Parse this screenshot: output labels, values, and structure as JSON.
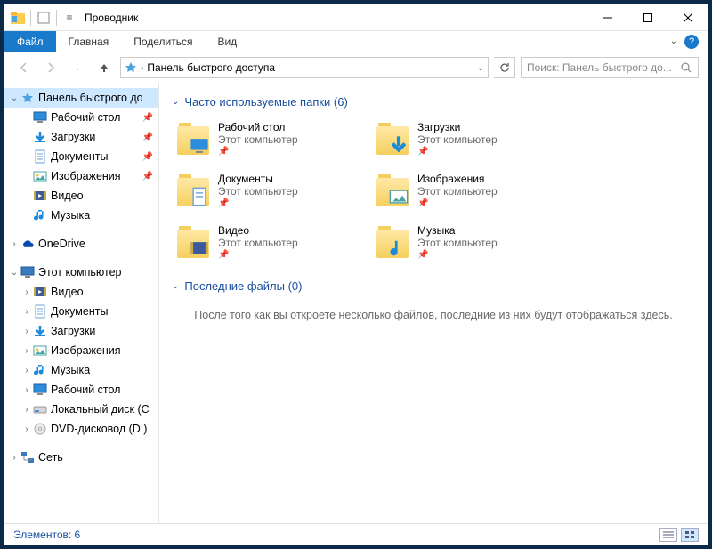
{
  "window": {
    "title": "Проводник"
  },
  "ribbon": {
    "file": "Файл",
    "tabs": [
      "Главная",
      "Поделиться",
      "Вид"
    ]
  },
  "address": {
    "path": "Панель быстрого доступа",
    "search_placeholder": "Поиск: Панель быстрого до..."
  },
  "sidebar": {
    "quick_access": "Панель быстрого до",
    "quick_items": [
      {
        "label": "Рабочий стол",
        "icon": "desktop",
        "pinned": true
      },
      {
        "label": "Загрузки",
        "icon": "downloads",
        "pinned": true
      },
      {
        "label": "Документы",
        "icon": "documents",
        "pinned": true
      },
      {
        "label": "Изображения",
        "icon": "pictures",
        "pinned": true
      },
      {
        "label": "Видео",
        "icon": "video",
        "pinned": false
      },
      {
        "label": "Музыка",
        "icon": "music",
        "pinned": false
      }
    ],
    "onedrive": "OneDrive",
    "this_pc": "Этот компьютер",
    "pc_items": [
      {
        "label": "Видео",
        "icon": "video"
      },
      {
        "label": "Документы",
        "icon": "documents"
      },
      {
        "label": "Загрузки",
        "icon": "downloads"
      },
      {
        "label": "Изображения",
        "icon": "pictures"
      },
      {
        "label": "Музыка",
        "icon": "music"
      },
      {
        "label": "Рабочий стол",
        "icon": "desktop"
      },
      {
        "label": "Локальный диск (C",
        "icon": "disk"
      },
      {
        "label": "DVD-дисковод (D:)",
        "icon": "dvd"
      }
    ],
    "network": "Сеть"
  },
  "content": {
    "group_frequent": "Часто используемые папки (6)",
    "group_recent": "Последние файлы (0)",
    "subtitle": "Этот компьютер",
    "folders": [
      {
        "name": "Рабочий стол",
        "icon": "desktop"
      },
      {
        "name": "Загрузки",
        "icon": "downloads"
      },
      {
        "name": "Документы",
        "icon": "documents"
      },
      {
        "name": "Изображения",
        "icon": "pictures"
      },
      {
        "name": "Видео",
        "icon": "video"
      },
      {
        "name": "Музыка",
        "icon": "music"
      }
    ],
    "empty_recent": "После того как вы откроете несколько файлов, последние из них будут отображаться здесь."
  },
  "statusbar": {
    "count": "Элементов: 6"
  }
}
